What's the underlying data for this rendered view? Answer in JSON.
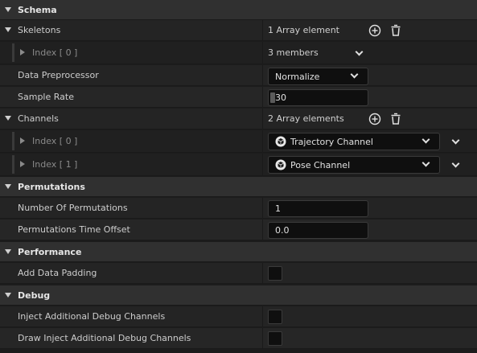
{
  "schema": {
    "title": "Schema",
    "skeletons": {
      "label": "Skeletons",
      "summary": "1 Array element",
      "items": [
        {
          "label": "Index [ 0 ]",
          "value": "3 members"
        }
      ]
    },
    "data_preprocessor": {
      "label": "Data Preprocessor",
      "value": "Normalize"
    },
    "sample_rate": {
      "label": "Sample Rate",
      "value": "30"
    },
    "channels": {
      "label": "Channels",
      "summary": "2 Array elements",
      "items": [
        {
          "label": "Index [ 0 ]",
          "value": "Trajectory Channel"
        },
        {
          "label": "Index [ 1 ]",
          "value": "Pose Channel"
        }
      ]
    }
  },
  "permutations": {
    "title": "Permutations",
    "number": {
      "label": "Number Of Permutations",
      "value": "1"
    },
    "time_offset": {
      "label": "Permutations Time Offset",
      "value": "0.0"
    }
  },
  "performance": {
    "title": "Performance",
    "add_padding": {
      "label": "Add Data Padding",
      "checked": false
    }
  },
  "debug": {
    "title": "Debug",
    "inject": {
      "label": "Inject Additional Debug Channels",
      "checked": false
    },
    "draw_inject": {
      "label": "Draw Inject Additional Debug Channels",
      "checked": false
    }
  }
}
